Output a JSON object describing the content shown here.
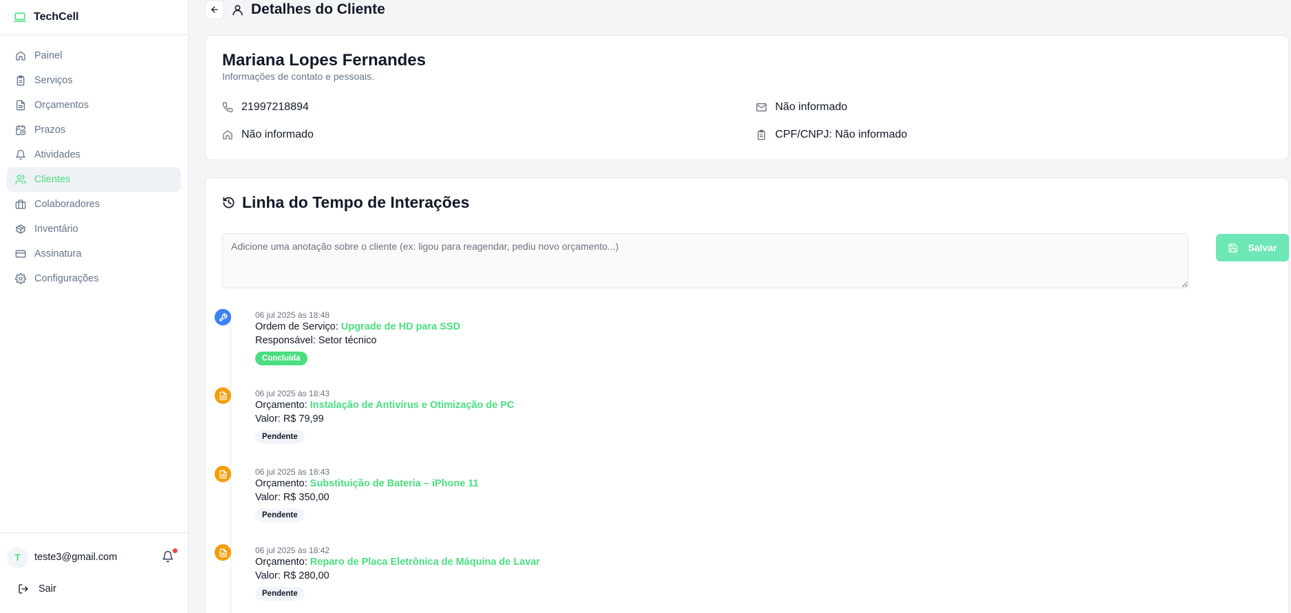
{
  "app": {
    "name": "TechCell",
    "accent": "#4ade80",
    "logo_icon": "laptop-icon"
  },
  "sidebar": {
    "items": [
      {
        "label": "Painel",
        "icon": "home-icon",
        "active": false
      },
      {
        "label": "Serviços",
        "icon": "clipboard-icon",
        "active": false
      },
      {
        "label": "Orçamentos",
        "icon": "file-text-icon",
        "active": false
      },
      {
        "label": "Prazos",
        "icon": "calendar-clock-icon",
        "active": false
      },
      {
        "label": "Atividades",
        "icon": "bell-icon",
        "active": false
      },
      {
        "label": "Clientes",
        "icon": "users-icon",
        "active": true
      },
      {
        "label": "Colaboradores",
        "icon": "briefcase-icon",
        "active": false
      },
      {
        "label": "Inventário",
        "icon": "package-icon",
        "active": false
      },
      {
        "label": "Assinatura",
        "icon": "credit-card-icon",
        "active": false
      },
      {
        "label": "Configurações",
        "icon": "gear-icon",
        "active": false
      }
    ],
    "user": {
      "initial": "T",
      "email": "teste3@gmail.com",
      "has_notification": true
    },
    "logout_label": "Sair"
  },
  "header": {
    "title": "Detalhes do Cliente"
  },
  "client": {
    "name": "Mariana Lopes Fernandes",
    "subtitle": "Informações de contato e pessoais.",
    "phone": "21997218894",
    "email": "Não informado",
    "address": "Não informado",
    "document": "CPF/CNPJ: Não informado"
  },
  "timeline": {
    "title": "Linha do Tempo de Interações",
    "note_placeholder": "Adicione uma anotação sobre o cliente (ex: ligou para reagendar, pediu novo orçamento...)",
    "save_label": "Salvar",
    "entries": [
      {
        "kind": "service",
        "date": "06 jul 2025 às 18:48",
        "prefix": "Ordem de Serviço:",
        "link": "Upgrade de HD para SSD",
        "detail": "Responsável: Setor técnico",
        "status": "Concluída"
      },
      {
        "kind": "quote",
        "date": "06 jul 2025 às 18:43",
        "prefix": "Orçamento:",
        "link": "Instalação de Antivírus e Otimização de PC",
        "detail": "Valor: R$ 79,99",
        "status": "Pendente"
      },
      {
        "kind": "quote",
        "date": "06 jul 2025 às 18:43",
        "prefix": "Orçamento:",
        "link": "Substituição de Bateria – iPhone 11",
        "detail": "Valor: R$ 350,00",
        "status": "Pendente"
      },
      {
        "kind": "quote",
        "date": "06 jul 2025 às 18:42",
        "prefix": "Orçamento:",
        "link": "Reparo de Placa Eletrônica de Máquina de Lavar",
        "detail": "Valor: R$ 280,00",
        "status": "Pendente"
      }
    ]
  },
  "colors": {
    "service_icon": "#3b82f6",
    "quote_icon": "#f59e0b",
    "done_badge": "#4ade80"
  }
}
